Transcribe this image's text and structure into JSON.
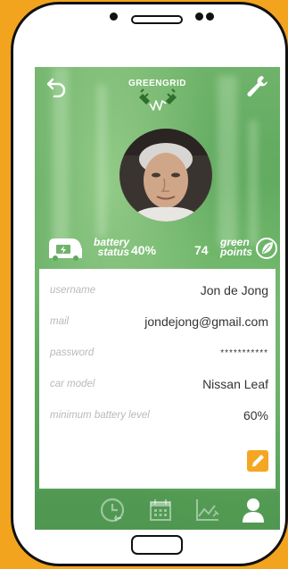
{
  "app": {
    "title": "GREENGRID"
  },
  "stats": {
    "battery_label_1": "battery",
    "battery_label_2": "status",
    "battery_value": "40%",
    "points_value": "74",
    "points_label_1": "green",
    "points_label_2": "points"
  },
  "profile": {
    "fields": [
      {
        "label": "username",
        "value": "Jon de Jong"
      },
      {
        "label": "mail",
        "value": "jondejong@gmail.com"
      },
      {
        "label": "password",
        "value": "***********"
      },
      {
        "label": "car model",
        "value": "Nissan Leaf"
      },
      {
        "label": "minimum battery level",
        "value": "60%"
      }
    ]
  },
  "nav": {
    "items": [
      "clock-icon",
      "calendar-icon",
      "chart-icon",
      "user-icon"
    ],
    "active": "user-icon"
  },
  "colors": {
    "background": "#f2a41e",
    "accent": "#f5a623",
    "brand_green": "#2f6f2e",
    "label_gray": "#b9b9b9"
  }
}
